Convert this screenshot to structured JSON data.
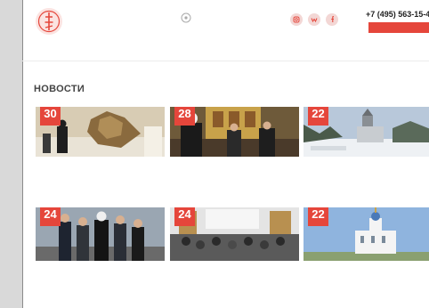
{
  "header": {
    "contact": {
      "address_line1": "",
      "address_line2": ""
    },
    "social": [
      {
        "icon": "instagram-icon"
      },
      {
        "icon": "vk-icon"
      },
      {
        "icon": "facebook-icon"
      }
    ],
    "phone": "+7 (495) 563-15-4",
    "help_button": ""
  },
  "nav": {
    "items": [
      {
        "label": ""
      },
      {
        "label": ""
      },
      {
        "label": ""
      },
      {
        "label": ""
      },
      {
        "label": ""
      },
      {
        "label": ""
      }
    ]
  },
  "breadcrumb": "",
  "page_title": "НОВОСТИ",
  "news": [
    {
      "day": "30",
      "month": "",
      "title": ""
    },
    {
      "day": "28",
      "month": "",
      "title": ""
    },
    {
      "day": "22",
      "month": "",
      "title": ""
    },
    {
      "day": "24",
      "month": "",
      "title": ""
    },
    {
      "day": "24",
      "month": "",
      "title": ""
    },
    {
      "day": "22",
      "month": "",
      "title": ""
    }
  ],
  "colors": {
    "accent": "#e5463b",
    "link": "#2a4a8a",
    "text": "#444444"
  }
}
